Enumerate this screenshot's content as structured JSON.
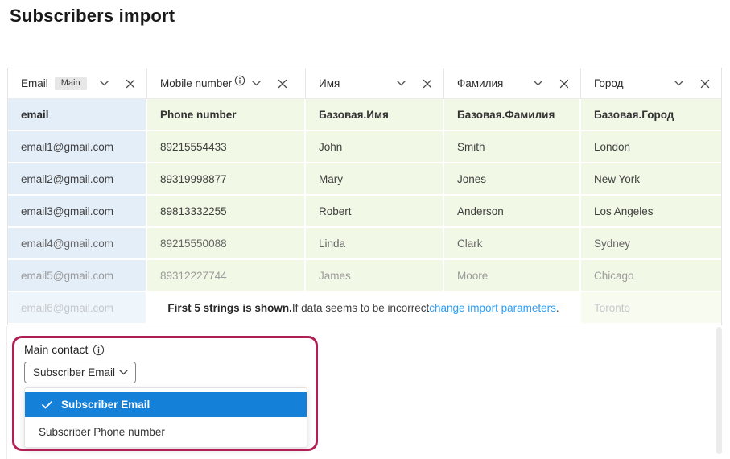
{
  "page": {
    "title": "Subscribers import"
  },
  "columns": [
    {
      "label": "Email",
      "badge": "Main"
    },
    {
      "label": "Mobile number"
    },
    {
      "label": "Имя"
    },
    {
      "label": "Фамилия"
    },
    {
      "label": "Город"
    }
  ],
  "field_row": [
    "email",
    "Phone number",
    "Базовая.Имя",
    "Базовая.Фамилия",
    "Базовая.Город"
  ],
  "rows": [
    [
      "email1@gmail.com",
      "89215554433",
      "John",
      "Smith",
      "London"
    ],
    [
      "email2@gmail.com",
      "89319998877",
      "Mary",
      "Jones",
      "New York"
    ],
    [
      "email3@gmail.com",
      "89813332255",
      "Robert",
      "Anderson",
      "Los Angeles"
    ],
    [
      "email4@gmail.com",
      "89215550088",
      "Linda",
      "Clark",
      "Sydney"
    ],
    [
      "email5@gmail.com",
      "89312227744",
      "James",
      "Moore",
      "Chicago"
    ]
  ],
  "partial_row": {
    "email": "email6@gmail.com",
    "city": "Toronto"
  },
  "notice": {
    "bold": "First 5 strings is shown.",
    "text": "If data seems to be incorrect ",
    "link": "change import parameters",
    "suffix": "."
  },
  "main_contact": {
    "label": "Main contact",
    "selected_value": "Subscriber Email",
    "options": [
      {
        "label": "Subscriber Email",
        "selected": true
      },
      {
        "label": "Subscriber Phone number",
        "selected": false
      }
    ]
  },
  "colors": {
    "email_column_bg": "#e4eef8",
    "mapped_column_bg": "#f2f8e6",
    "selected_option_bg": "#1580d8",
    "link_blue": "#2e9df1",
    "annotation_pink": "#b02054"
  }
}
